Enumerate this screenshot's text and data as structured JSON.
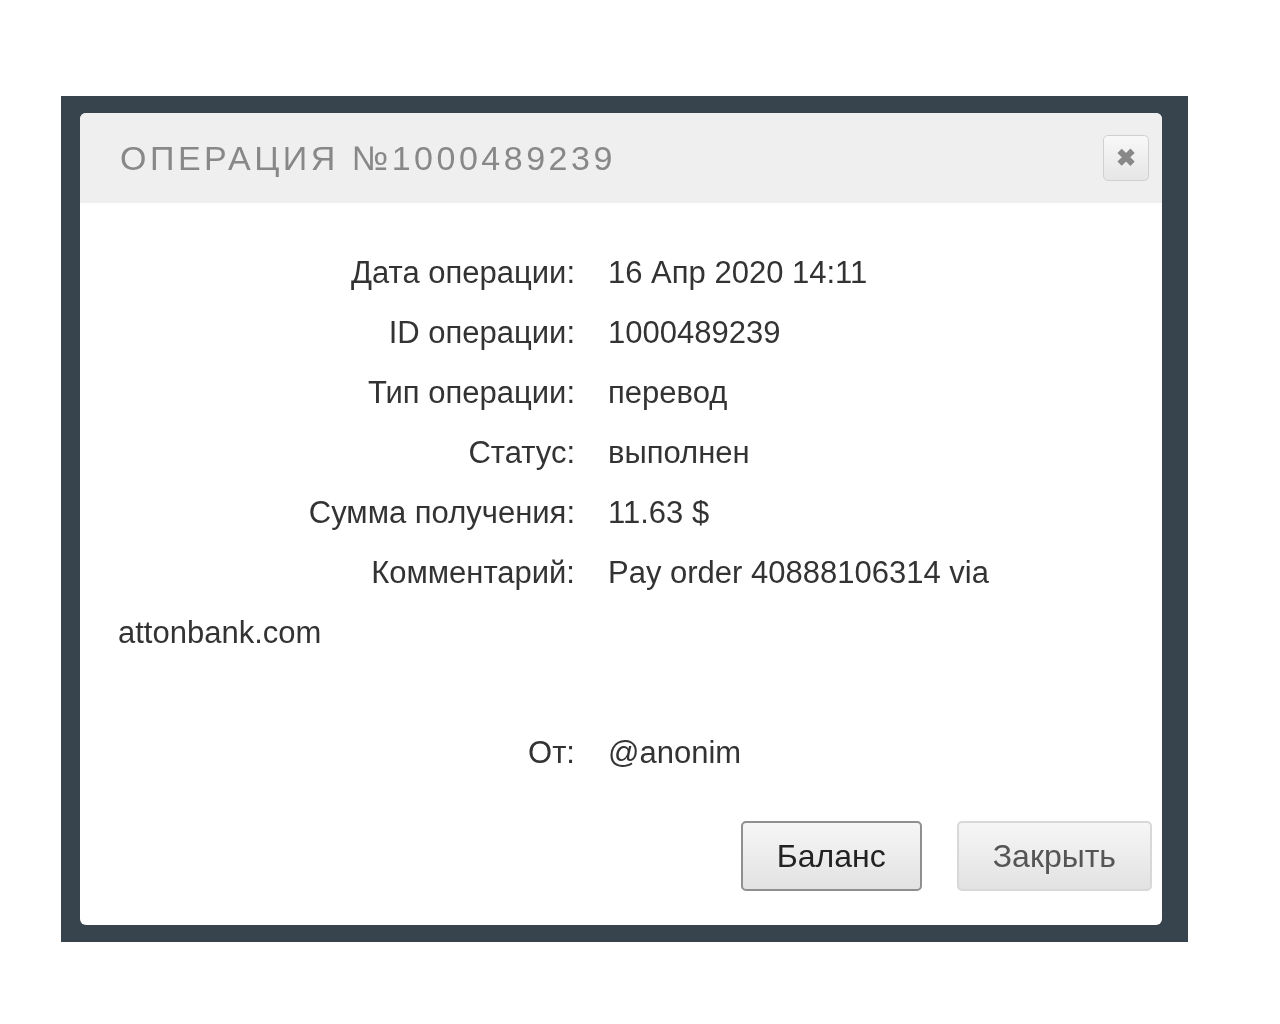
{
  "dialog": {
    "title": "ОПЕРАЦИЯ №1000489239",
    "close_icon": "✖",
    "fields": [
      {
        "label": "Дата операции:",
        "value": "16 Апр 2020 14:11"
      },
      {
        "label": "ID операции:",
        "value": "1000489239"
      },
      {
        "label": "Тип операции:",
        "value": "перевод"
      },
      {
        "label": "Статус:",
        "value": "выполнен"
      },
      {
        "label": "Сумма получения:",
        "value": "11.63 $"
      },
      {
        "label": "Комментарий:",
        "value": "Pay order 40888106314 via",
        "continued": "attonbank.com"
      }
    ],
    "sender": {
      "label": "От:",
      "value": "@anonim"
    },
    "buttons": [
      {
        "label": "Баланс",
        "focused": true
      },
      {
        "label": "Закрыть",
        "focused": false
      }
    ]
  }
}
